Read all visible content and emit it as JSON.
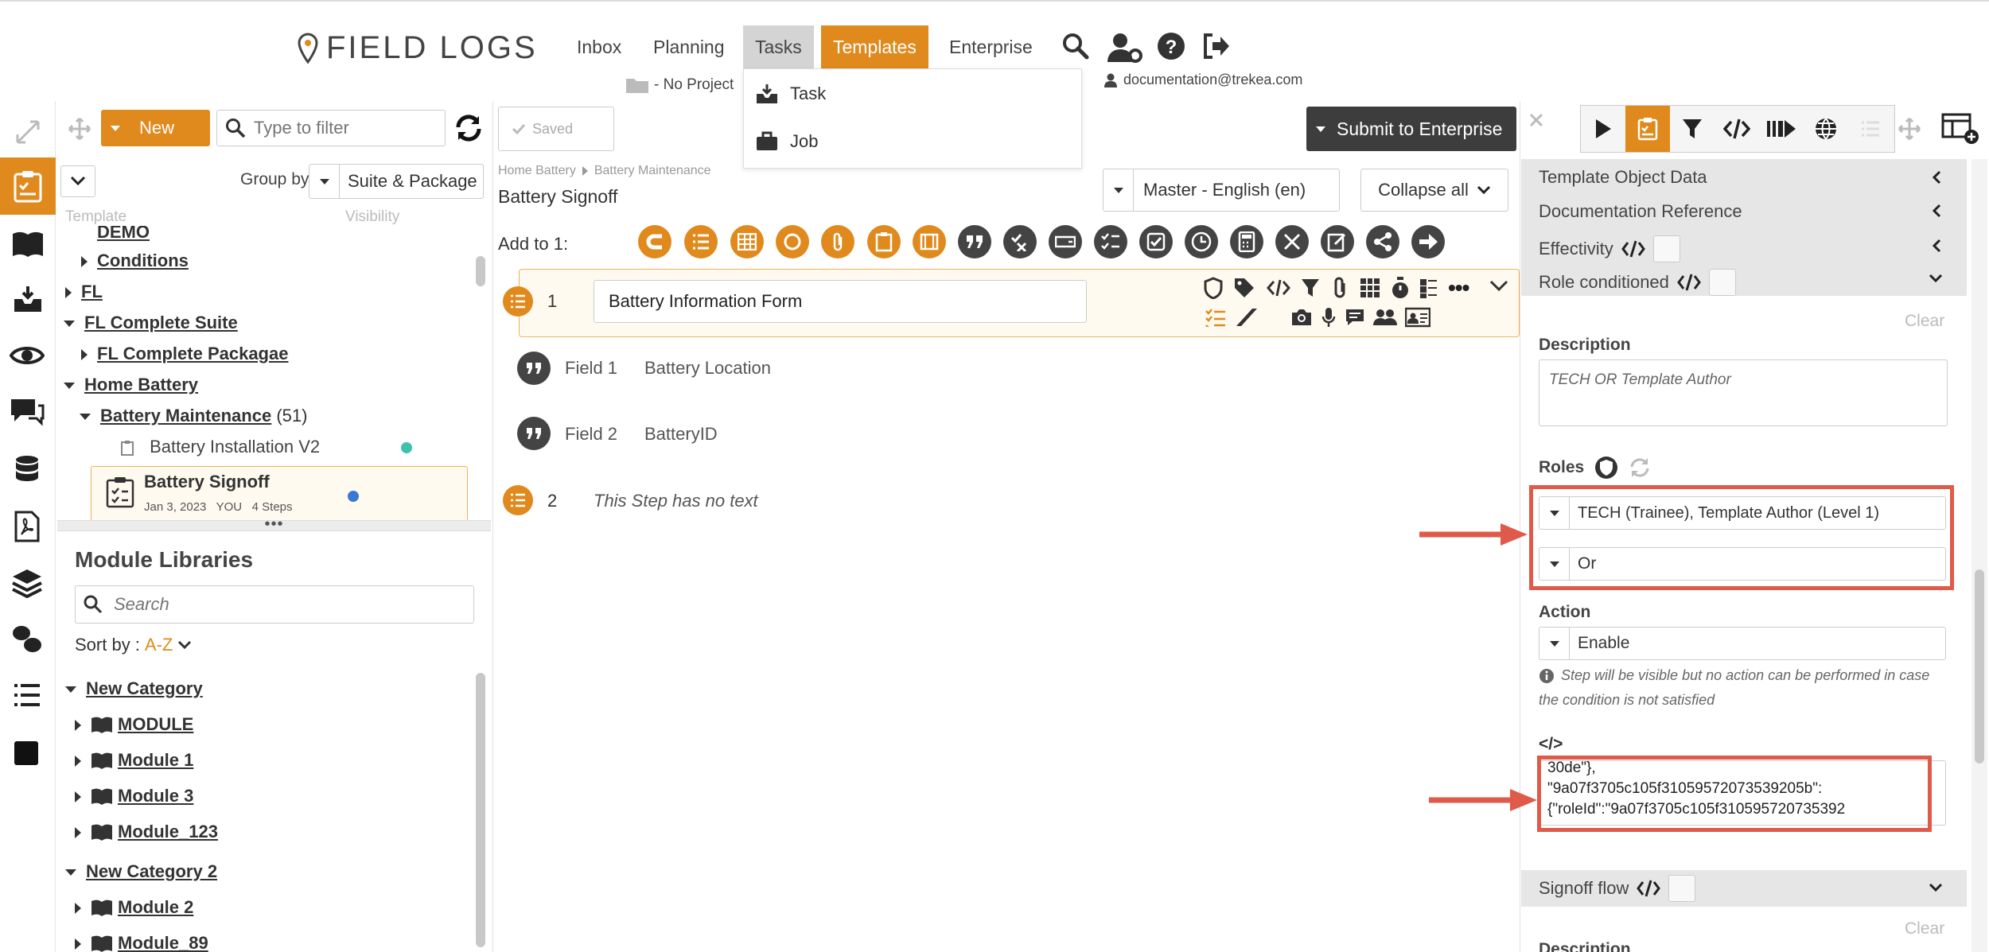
{
  "nav": {
    "logo": "FIELD LOGS",
    "items": [
      "Inbox",
      "Planning",
      "Tasks",
      "Templates",
      "Enterprise"
    ],
    "project": "- No Project",
    "user_email": "documentation@trekea.com",
    "tasks_menu": [
      "Task",
      "Job"
    ]
  },
  "toolbar": {
    "new_label": "New",
    "filter_placeholder": "Type to filter",
    "saved_label": "Saved",
    "submit_label": "Submit to Enterprise"
  },
  "template_panel": {
    "group_by_label": "Group by",
    "group_by_value": "Suite & Package",
    "col_template": "Template",
    "col_visibility": "Visibility",
    "cut_item": "DEMO",
    "tree": [
      {
        "label": "Conditions",
        "level": 1,
        "expanded": false
      },
      {
        "label": "FL",
        "level": 0,
        "expanded": false
      },
      {
        "label": "FL Complete Suite",
        "level": 0,
        "expanded": true
      },
      {
        "label": "FL Complete Packagae",
        "level": 1,
        "expanded": false
      },
      {
        "label": "Home Battery",
        "level": 0,
        "expanded": true
      },
      {
        "label": "Battery Maintenance",
        "count": "(51)",
        "level": 1,
        "expanded": true
      }
    ],
    "item_installation": "Battery Installation V2",
    "item_signoff": "Battery Signoff",
    "item_signoff_meta": "Jan 3, 2023   YOU   4 Steps",
    "visibility_colors": [
      "#3fc1b0",
      "#3a78d6"
    ]
  },
  "modules": {
    "title": "Module Libraries",
    "search_placeholder": "Search",
    "sort_label": "Sort by :",
    "sort_value": "A-Z",
    "tree": [
      {
        "label": "New Category",
        "folder": true,
        "level": 0
      },
      {
        "label": "MODULE",
        "level": 1
      },
      {
        "label": "Module 1",
        "level": 1
      },
      {
        "label": "Module 3",
        "level": 1
      },
      {
        "label": "Module_123",
        "level": 1
      },
      {
        "label": "New Category 2",
        "folder": true,
        "level": 0
      },
      {
        "label": "Module 2",
        "level": 1
      },
      {
        "label": "Module_89",
        "level": 1
      }
    ]
  },
  "editor": {
    "breadcrumb_1": "Home Battery",
    "breadcrumb_2": "Battery Maintenance",
    "title": "Battery Signoff",
    "language": "Master - English (en)",
    "collapse_label": "Collapse all",
    "add_to_label": "Add to 1:",
    "step1_num": "1",
    "step1_title": "Battery Information Form",
    "field1_label": "Field 1",
    "field1_value": "Battery Location",
    "field2_label": "Field 2",
    "field2_value": "BatteryID",
    "step2_num": "2",
    "step2_text": "This Step has no text"
  },
  "right": {
    "sections": [
      "Template Object Data",
      "Documentation Reference",
      "Effectivity",
      "Role conditioned"
    ],
    "clear": "Clear",
    "description_label": "Description",
    "description_placeholder": "TECH OR Template Author",
    "roles_label": "Roles",
    "roles_value": "TECH (Trainee), Template Author (Level 1)",
    "operator_value": "Or",
    "action_label": "Action",
    "action_value": "Enable",
    "action_hint": "Step will be visible but no action can be performed in case the condition is not satisfied",
    "code_icon": "</>",
    "code_lines": [
      "30de\"},",
      "\"9a07f3705c105f31059572073539205b\":",
      "{\"roleId\":\"9a07f3705c105f310595720735392"
    ],
    "signoff_flow": "Signoff flow",
    "clear2": "Clear",
    "description2": "Description"
  },
  "colors": {
    "accent": "#e08a1e",
    "annotation": "#e05a4a",
    "dark": "#444444"
  }
}
